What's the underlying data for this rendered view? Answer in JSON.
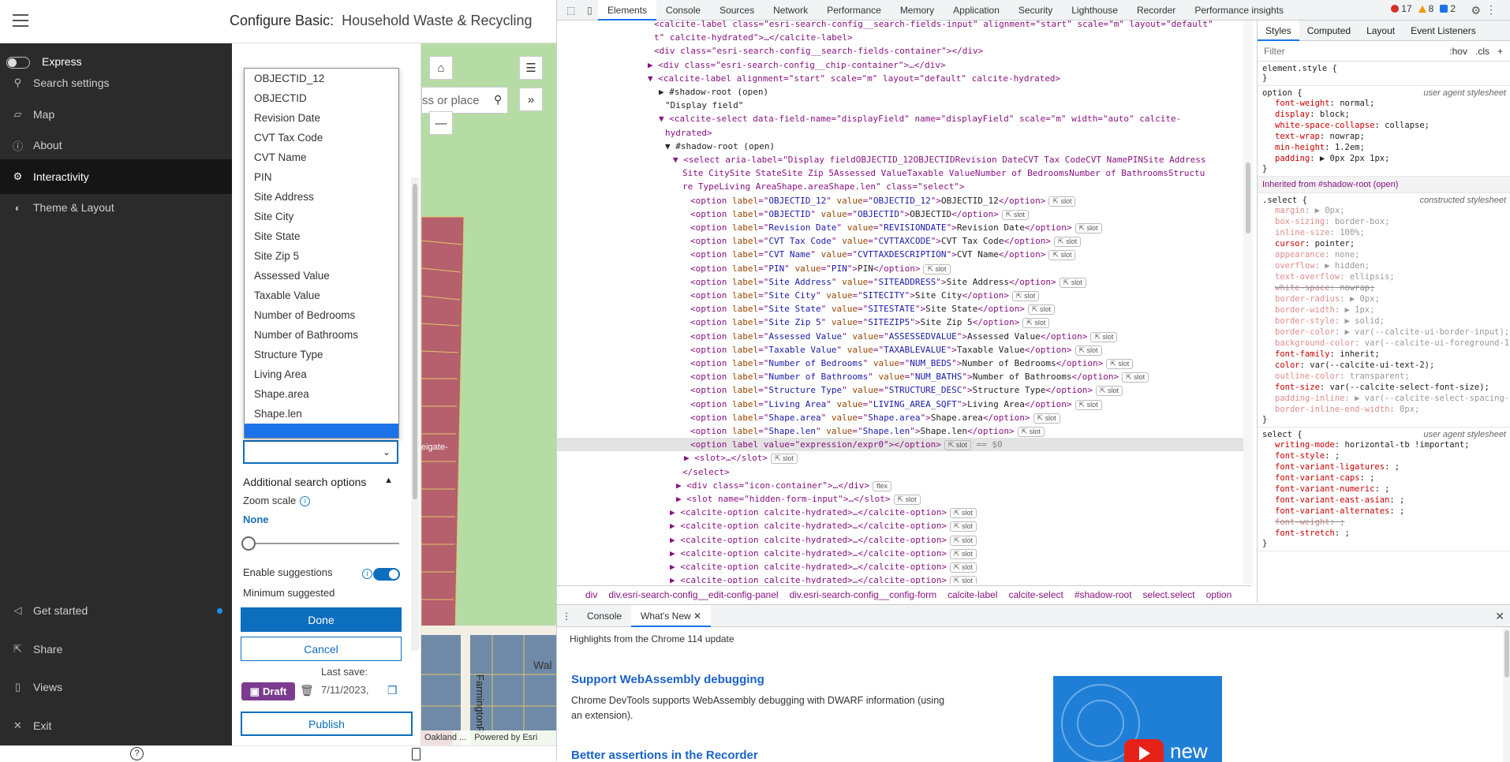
{
  "app": {
    "title_prefix": "Configure Basic:",
    "title_name": "Household Waste & Recycling",
    "express_label": "Express",
    "sidebar": [
      {
        "label": "Search settings",
        "icon": "search-icon"
      },
      {
        "label": "Map",
        "icon": "map-icon"
      },
      {
        "label": "About",
        "icon": "info-icon"
      },
      {
        "label": "Interactivity",
        "icon": "gear-icon",
        "active": true
      },
      {
        "label": "Theme & Layout",
        "icon": "palette-icon"
      }
    ],
    "sidebar_bottom": [
      {
        "label": "Get started",
        "icon": "megaphone-icon"
      },
      {
        "label": "Share",
        "icon": "share-icon"
      },
      {
        "label": "Views",
        "icon": "phone-icon"
      },
      {
        "label": "Exit",
        "icon": "close-icon"
      }
    ],
    "dropdown_options": [
      "OBJECTID_12",
      "OBJECTID",
      "Revision Date",
      "CVT Tax Code",
      "CVT Name",
      "PIN",
      "Site Address",
      "Site City",
      "Site State",
      "Site Zip 5",
      "Assessed Value",
      "Taxable Value",
      "Number of Bedrooms",
      "Number of Bathrooms",
      "Structure Type",
      "Living Area",
      "Shape.area",
      "Shape.len"
    ],
    "additional_search_options": "Additional search options",
    "zoom_scale_label": "Zoom scale",
    "zoom_scale_value": "None",
    "enable_suggestions": "Enable suggestions",
    "min_suggested": "Minimum suggested",
    "done": "Done",
    "cancel": "Cancel",
    "last_save_label": "Last save:",
    "last_save_date": "7/11/2023,",
    "draft": "Draft",
    "publish": "Publish"
  },
  "map": {
    "search_placeholder": "ss or place",
    "street_label_1": "eigate-",
    "street_label_2": "Wal",
    "street_label_3": "FarmingtonR",
    "attribution_1": "Oakland ...",
    "attribution_2": "Powered by Esri"
  },
  "devtools": {
    "tabs": [
      "Elements",
      "Console",
      "Sources",
      "Network",
      "Performance",
      "Memory",
      "Application",
      "Security",
      "Lighthouse",
      "Recorder",
      "Performance insights"
    ],
    "active_tab": "Elements",
    "errors": "17",
    "warnings": "8",
    "info": "2",
    "style_tabs": [
      "Styles",
      "Computed",
      "Layout",
      "Event Listeners"
    ],
    "filter_placeholder": "Filter",
    "hov": ":hov",
    "cls": ".cls",
    "breadcrumbs": [
      "div",
      "div.esri-search-config__edit-config-panel",
      "div.esri-search-config__config-form",
      "calcite-label",
      "calcite-select",
      "#shadow-root",
      "select.select",
      "option"
    ],
    "drawer_tabs": [
      "Console",
      "What's New"
    ],
    "highlights": "Highlights from the Chrome 114 update",
    "wn_h1": "Support WebAssembly debugging",
    "wn_p": "Chrome DevTools supports WebAssembly debugging with DWARF information (using an extension).",
    "wn_h2": "Better assertions in the Recorder",
    "wn_new": "new",
    "element_style": "element.style {",
    "inherited_from": "Inherited from",
    "inherited_target": "#shadow-root (open)",
    "user_agent": "user agent stylesheet",
    "constructed": "constructed stylesheet",
    "dom_lines": {
      "l0": "<calcite-label class=\"esri-search-config__search-fields-input\" alignment=\"start\" scale=\"m\" layout=\"default\"",
      "l1": "t\" calcite-hydrated\">…</calcite-label>",
      "l2": "<div class=\"esri-search-config__search-fields-container\"></div>",
      "l3": "<div class=\"esri-search-config__chip-container\">…</div>",
      "l4": "<calcite-label alignment=\"start\" scale=\"m\" layout=\"default\" calcite-hydrated>",
      "l5": "#shadow-root (open)",
      "l6": "\"Display field\"",
      "l7": "<calcite-select data-field-name=\"displayField\" name=\"displayField\" scale=\"m\" width=\"auto\" calcite-",
      "l8": "hydrated>",
      "l9": "#shadow-root (open)",
      "l10": "<select aria-label=\"Display fieldOBJECTID_12OBJECTIDRevision DateCVT Tax CodeCVT NamePINSite Address",
      "l11": "Site CitySite StateSite Zip 5Assessed ValueTaxable ValueNumber of BedroomsNumber of BathroomsStructu",
      "l12": "re TypeLiving AreaShape.areaShape.len\" class=\"select\">",
      "expr": "<option label value=\"expression/expr0\"></option>",
      "eq": "== $0",
      "slot": "<slot>…</slot>",
      "endsel": "</select>",
      "iconc": "<div class=\"icon-container\">…</div>",
      "hidden": "<slot name=\"hidden-form-input\">…</slot>",
      "copt": "<calcite-option calcite-hydrated>…</calcite-option>"
    },
    "option_rows": [
      [
        "OBJECTID_12",
        "OBJECTID_12",
        "OBJECTID_12"
      ],
      [
        "OBJECTID",
        "OBJECTID",
        "OBJECTID"
      ],
      [
        "Revision Date",
        "REVISIONDATE",
        "Revision Date"
      ],
      [
        "CVT Tax Code",
        "CVTTAXCODE",
        "CVT Tax Code"
      ],
      [
        "CVT Name",
        "CVTTAXDESCRIPTION",
        "CVT Name"
      ],
      [
        "PIN",
        "PIN",
        "PIN"
      ],
      [
        "Site Address",
        "SITEADDRESS",
        "Site Address"
      ],
      [
        "Site City",
        "SITECITY",
        "Site City"
      ],
      [
        "Site State",
        "SITESTATE",
        "Site State"
      ],
      [
        "Site Zip 5",
        "SITEZIP5",
        "Site Zip 5"
      ],
      [
        "Assessed Value",
        "ASSESSEDVALUE",
        "Assessed Value"
      ],
      [
        "Taxable Value",
        "TAXABLEVALUE",
        "Taxable Value"
      ],
      [
        "Number of Bedrooms",
        "NUM_BEDS",
        "Number of Bedrooms"
      ],
      [
        "Number of Bathrooms",
        "NUM_BATHS",
        "Number of Bathrooms"
      ],
      [
        "Structure Type",
        "STRUCTURE_DESC",
        "Structure Type"
      ],
      [
        "Living Area",
        "LIVING_AREA_SQFT",
        "Living Area"
      ],
      [
        "Shape.area",
        "Shape.area",
        "Shape.area"
      ],
      [
        "Shape.len",
        "Shape.len",
        "Shape.len"
      ]
    ],
    "rules": [
      {
        "sel": "option {",
        "src": "user agent stylesheet",
        "props": [
          [
            "font-weight",
            "normal;",
            ""
          ],
          [
            "display",
            "block;",
            ""
          ],
          [
            "white-space-collapse",
            "collapse;",
            ""
          ],
          [
            "text-wrap",
            "nowrap;",
            ""
          ],
          [
            "min-height",
            "1.2em;",
            ""
          ],
          [
            "padding",
            "▶ 0px 2px 1px;",
            ""
          ]
        ]
      }
    ],
    "select_rule": [
      [
        "margin",
        "▶ 0px;",
        "dim"
      ],
      [
        "box-sizing",
        "border-box;",
        "dim"
      ],
      [
        "inline-size",
        "100%;",
        "dim"
      ],
      [
        "cursor",
        "pointer;",
        ""
      ],
      [
        "appearance",
        "none;",
        "dim"
      ],
      [
        "overflow",
        "▶ hidden;",
        "dim"
      ],
      [
        "text-overflow",
        "ellipsis;",
        "dim"
      ],
      [
        "white-space",
        "nowrap;",
        "strike"
      ],
      [
        "border-radius",
        "▶ 0px;",
        "dim"
      ],
      [
        "border-width",
        "▶ 1px;",
        "dim"
      ],
      [
        "border-style",
        "▶ solid;",
        "dim"
      ],
      [
        "border-color",
        "▶ var(--calcite-ui-border-input);",
        "dim"
      ],
      [
        "background-color",
        "var(--calcite-ui-foreground-1);",
        "dim"
      ],
      [
        "font-family",
        "inherit;",
        ""
      ],
      [
        "color",
        "var(--calcite-ui-text-2);",
        ""
      ],
      [
        "outline-color",
        "transparent;",
        "dim"
      ],
      [
        "font-size",
        "var(--calcite-select-font-size);",
        ""
      ],
      [
        "padding-inline",
        "▶ var(--calcite-select-spacing-inline);",
        "dim"
      ],
      [
        "border-inline-end-width",
        "0px;",
        "dim"
      ]
    ],
    "select2_rule": [
      [
        "writing-mode",
        "horizontal-tb !important;",
        ""
      ],
      [
        "font-style",
        ";",
        ""
      ],
      [
        "font-variant-ligatures",
        ";",
        ""
      ],
      [
        "font-variant-caps",
        ";",
        ""
      ],
      [
        "font-variant-numeric",
        ";",
        ""
      ],
      [
        "font-variant-east-asian",
        ";",
        ""
      ],
      [
        "font-variant-alternates",
        ";",
        ""
      ],
      [
        "font-weight",
        ";",
        "strike"
      ],
      [
        "font-stretch",
        ";",
        ""
      ]
    ]
  }
}
